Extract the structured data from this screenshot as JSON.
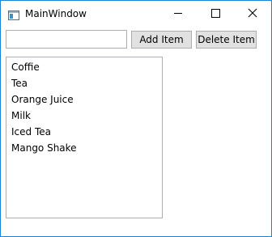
{
  "window": {
    "title": "MainWindow",
    "border_color": "#1883d7"
  },
  "titlebar": {
    "icon": "app-window-icon",
    "minimize_icon": "minimize-icon",
    "maximize_icon": "maximize-icon",
    "close_icon": "close-icon"
  },
  "toolbar": {
    "item_input_value": "",
    "add_label": "Add Item",
    "delete_label": "Delete Item"
  },
  "list": {
    "items": [
      "Coffie",
      "Tea",
      "Orange Juice",
      "Milk",
      "Iced Tea",
      "Mango Shake"
    ]
  }
}
